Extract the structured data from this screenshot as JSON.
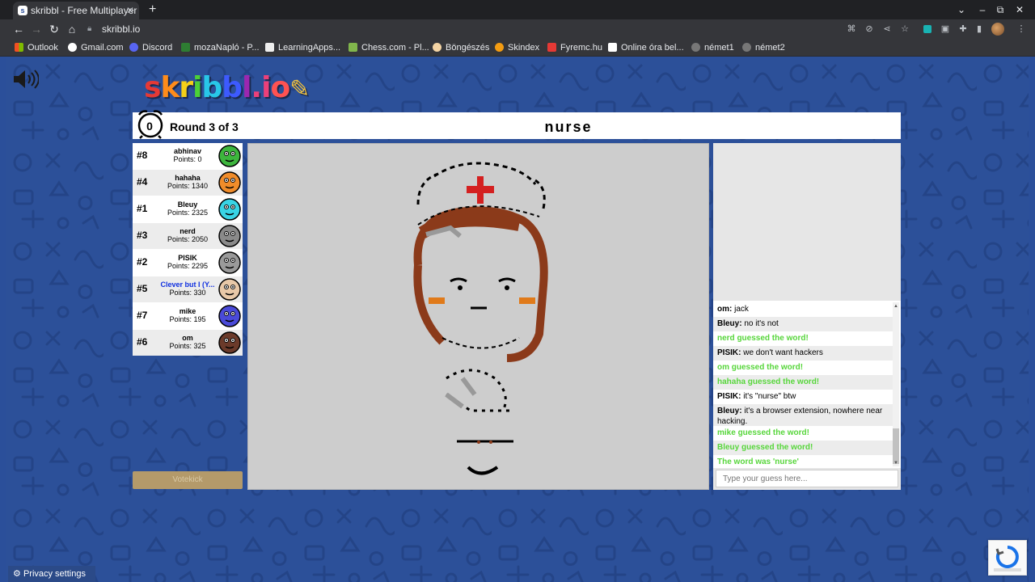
{
  "browser": {
    "tab_title": "skribbl - Free Multiplayer",
    "url": "skribbl.io",
    "bookmarks": [
      "Outlook",
      "Gmail.com",
      "Discord",
      "mozaNapló - P...",
      "LearningApps...",
      "Chess.com - Pl...",
      "Böngészés",
      "Skindex",
      "Fyremc.hu",
      "Online óra bel...",
      "német1",
      "német2"
    ]
  },
  "game": {
    "logo": "skribbl.io",
    "timer": "0",
    "round": "Round 3 of 3",
    "word": "nurse",
    "votekick_label": "Votekick"
  },
  "players": [
    {
      "rank": "#8",
      "name": "abhinav",
      "points": "Points: 0",
      "color": "#3db53d"
    },
    {
      "rank": "#4",
      "name": "hahaha",
      "points": "Points: 1340",
      "color": "#f08c2a"
    },
    {
      "rank": "#1",
      "name": "Bleuy",
      "points": "Points: 2325",
      "color": "#39d4e6"
    },
    {
      "rank": "#3",
      "name": "nerd",
      "points": "Points: 2050",
      "color": "#8a8a8a"
    },
    {
      "rank": "#2",
      "name": "PISIK",
      "points": "Points: 2295",
      "color": "#9a9a9a"
    },
    {
      "rank": "#5",
      "name": "Clever but I (Y...",
      "points": "Points: 330",
      "color": "#e8c8a8"
    },
    {
      "rank": "#7",
      "name": "mike",
      "points": "Points: 195",
      "color": "#4a4ad8"
    },
    {
      "rank": "#6",
      "name": "om",
      "points": "Points: 325",
      "color": "#6b3a2a"
    }
  ],
  "chat": [
    {
      "user": "om:",
      "text": " jack",
      "type": "normal"
    },
    {
      "user": "Bleuy:",
      "text": " no it's not",
      "type": "normal"
    },
    {
      "user": "",
      "text": "nerd guessed the word!",
      "type": "green"
    },
    {
      "user": "PISIK:",
      "text": " we don't want hackers",
      "type": "normal"
    },
    {
      "user": "",
      "text": "om guessed the word!",
      "type": "green"
    },
    {
      "user": "",
      "text": "hahaha guessed the word!",
      "type": "green"
    },
    {
      "user": "PISIK:",
      "text": " it's \"nurse\" btw",
      "type": "normal"
    },
    {
      "user": "Bleuy:",
      "text": " it's a browser extension, nowhere near hacking.",
      "type": "normal"
    },
    {
      "user": "",
      "text": "mike guessed the word!",
      "type": "green"
    },
    {
      "user": "",
      "text": "Bleuy guessed the word!",
      "type": "green"
    },
    {
      "user": "",
      "text": "The word was 'nurse'",
      "type": "green"
    }
  ],
  "guess_placeholder": "Type your guess here...",
  "privacy_label": "Privacy settings"
}
